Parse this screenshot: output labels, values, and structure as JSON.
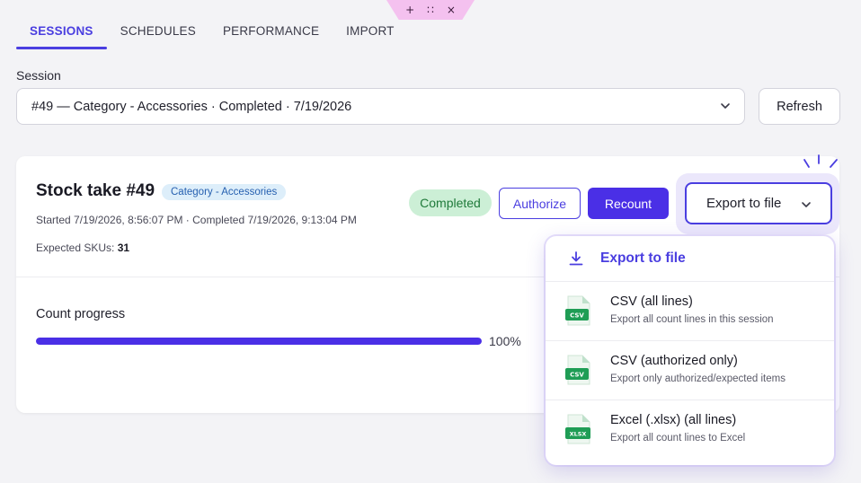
{
  "toolbar": {
    "plus": "+",
    "grip": "∷",
    "close": "×"
  },
  "tabs": [
    {
      "label": "SESSIONS",
      "active": true
    },
    {
      "label": "SCHEDULES",
      "active": false
    },
    {
      "label": "PERFORMANCE",
      "active": false
    },
    {
      "label": "IMPORT",
      "active": false
    }
  ],
  "session": {
    "label": "Session",
    "selected": "#49 — Category - Accessories · Completed · 7/19/2026",
    "refresh_label": "Refresh"
  },
  "stocktake": {
    "title": "Stock take #49",
    "category_badge": "Category - Accessories",
    "times": "Started 7/19/2026, 8:56:07 PM · Completed 7/19/2026, 9:13:04 PM",
    "expected_label": "Expected SKUs:",
    "expected_value": "31",
    "status": "Completed",
    "authorize_label": "Authorize",
    "recount_label": "Recount",
    "export_label": "Export to file",
    "progress_label": "Count progress",
    "progress_value": 100,
    "progress_text": "100%"
  },
  "export_menu": {
    "header": "Export to file",
    "items": [
      {
        "name": "CSV (all lines)",
        "desc": "Export all count lines in this session",
        "badge": "CSV"
      },
      {
        "name": "CSV (authorized only)",
        "desc": "Export only authorized/expected items",
        "badge": "CSV"
      },
      {
        "name": "Excel (.xlsx) (all lines)",
        "desc": "Export all count lines to Excel",
        "badge": "XLSX"
      }
    ]
  },
  "colors": {
    "accent": "#4a3ee0",
    "primary_button": "#4a2fe6",
    "success_bg": "#ccefd6",
    "file_green": "#1f9d55"
  },
  "icons": [
    "chevron-down-icon",
    "download-icon",
    "csv-file-icon",
    "xlsx-file-icon",
    "sparkle-icon"
  ]
}
